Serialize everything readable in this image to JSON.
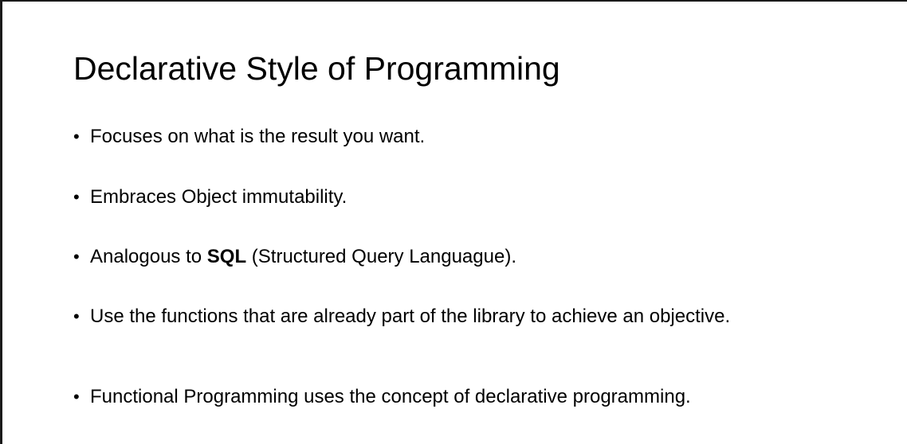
{
  "slide": {
    "title": "Declarative Style of Programming",
    "bullet_glyph": "•",
    "bullets": [
      {
        "text": "Focuses on what is the result you want."
      },
      {
        "text": "Embraces Object immutability."
      },
      {
        "prefix": "Analogous to ",
        "bold": "SQL",
        "suffix": " (Structured Query Languague)."
      },
      {
        "text": "Use the functions that are already part of the library to achieve an objective."
      },
      {
        "text": "Functional Programming uses the concept of declarative programming."
      }
    ]
  }
}
